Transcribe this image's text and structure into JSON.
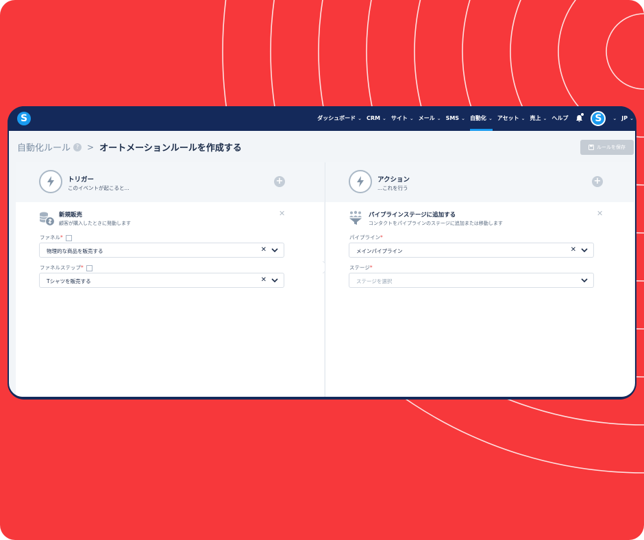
{
  "app": {
    "logo_letter": "S"
  },
  "nav": {
    "items": [
      {
        "label": "ダッシュボード",
        "chevron": true
      },
      {
        "label": "CRM",
        "chevron": true
      },
      {
        "label": "サイト",
        "chevron": true
      },
      {
        "label": "メール",
        "chevron": true
      },
      {
        "label": "SMS",
        "chevron": true
      },
      {
        "label": "自動化",
        "chevron": true,
        "active": true
      },
      {
        "label": "アセット",
        "chevron": true
      },
      {
        "label": "売上",
        "chevron": true
      },
      {
        "label": "ヘルプ",
        "chevron": false
      }
    ],
    "avatar_letter": "S",
    "language": "JP"
  },
  "breadcrumb": {
    "parent": "自動化ルール",
    "separator": ">",
    "current": "オートメーションルールを作成する"
  },
  "save_button": {
    "label": "ルールを保存",
    "enabled": false
  },
  "trigger": {
    "title": "トリガー",
    "subtitle": "このイベントが起こると...",
    "block": {
      "title": "新規販売",
      "subtitle": "顧客が購入したときに発動します",
      "fields": [
        {
          "label": "ファネル",
          "required": true,
          "value": "物理的な商品を販売する",
          "placeholder": "",
          "clearable": true
        },
        {
          "label": "ファネルステップ",
          "required": true,
          "value": "Tシャツを販売する",
          "placeholder": "",
          "clearable": true
        }
      ]
    }
  },
  "action": {
    "title": "アクション",
    "subtitle": "...これを行う",
    "block": {
      "title": "パイプラインステージに追加する",
      "subtitle": "コンタクトをパイプラインのステージに追加または移動します",
      "fields": [
        {
          "label": "パイプライン",
          "required": true,
          "value": "メインパイプライン",
          "placeholder": "",
          "clearable": true
        },
        {
          "label": "ステージ",
          "required": true,
          "value": "",
          "placeholder": "ステージを選択",
          "clearable": false
        }
      ]
    }
  },
  "icons": {
    "trigger": "lightning-bolt-icon",
    "action": "lightning-bolt-icon",
    "sale": "coins-dollar-icon",
    "pipeline": "people-funnel-icon",
    "save": "floppy-disk-icon",
    "bell": "bell-icon"
  },
  "colors": {
    "background": "#f7383b",
    "navbar": "#14295a",
    "accent": "#1a9bf0",
    "text_dark": "#1a2b48",
    "required": "#e94a4a"
  },
  "glyphs": {
    "required_mark": "*",
    "chevron": "⌄",
    "clear": "✕",
    "close": "✕",
    "plus": "+",
    "info": "?"
  }
}
